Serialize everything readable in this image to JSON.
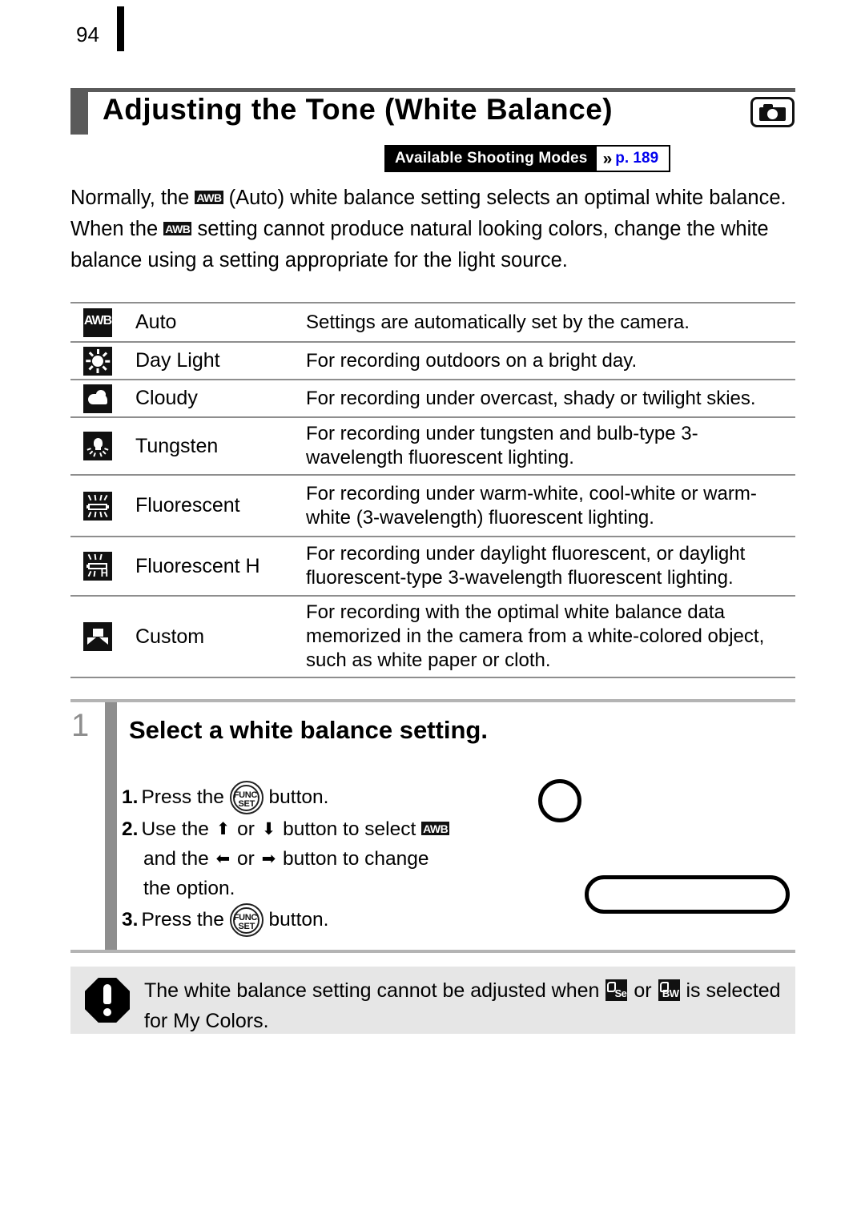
{
  "page": {
    "number": "94"
  },
  "header": {
    "title": "Adjusting the Tone (White Balance)",
    "camera_icon": "camera-icon",
    "modes_badge": {
      "label": "Available Shooting Modes",
      "chevron": "»",
      "page_ref": "p. 189",
      "page_ref_color": "#0000ee"
    }
  },
  "intro": {
    "part1": "Normally, the ",
    "icon1": "AWB",
    "part2": " (Auto) white balance setting selects an optimal white balance. When the ",
    "icon2": "AWB",
    "part3": " setting cannot produce natural looking colors, change the white balance using a setting appropriate for the light source."
  },
  "table": {
    "rows": [
      {
        "icon": "awb-icon",
        "name": "Auto",
        "description": "Settings are automatically set by the camera."
      },
      {
        "icon": "daylight-sun-icon",
        "name": "Day Light",
        "description": "For recording outdoors on a bright day."
      },
      {
        "icon": "cloudy-cloud-icon",
        "name": "Cloudy",
        "description": "For recording under overcast, shady or twilight skies."
      },
      {
        "icon": "tungsten-bulb-icon",
        "name": "Tungsten",
        "description": "For recording under tungsten and bulb-type 3-wavelength fluorescent lighting."
      },
      {
        "icon": "fluorescent-tube-icon",
        "name": "Fluorescent",
        "description": "For recording under warm-white, cool-white or warm-white (3-wavelength) fluorescent lighting."
      },
      {
        "icon": "fluorescent-h-icon",
        "name": "Fluorescent H",
        "description": "For recording under daylight fluorescent, or daylight fluorescent-type 3-wavelength fluorescent lighting."
      },
      {
        "icon": "custom-icon",
        "name": "Custom",
        "description": "For recording with the optimal white balance data memorized in the camera from a white-colored object, such as white paper or cloth."
      }
    ]
  },
  "step": {
    "number": "1",
    "title": "Select a white balance setting.",
    "items": [
      {
        "num": "1.",
        "text_before": "Press the ",
        "icon": "FUNC./SET",
        "text_after": " button."
      },
      {
        "num": "2.",
        "line1_a": "Use the ",
        "arrow_up": "⬆",
        "line1_b": " or ",
        "arrow_down": "⬇",
        "line1_c": " button to select ",
        "line1_icon": "AWB",
        "line2_a": "and the ",
        "arrow_left": "⬅",
        "line2_b": " or ",
        "arrow_right": "➡",
        "line2_c": " button to change",
        "line3": "the option."
      },
      {
        "num": "3.",
        "text_before": "Press the ",
        "icon": "FUNC./SET",
        "text_after": " button."
      }
    ],
    "func_set_icon": {
      "top": "FUNC.",
      "bottom": "SET"
    }
  },
  "illustration": {
    "circle": "button-outline-circle",
    "pill": "screen-outline-pill"
  },
  "note": {
    "icon": "warning-exclamation-icon",
    "text_a": "The white balance setting cannot be adjusted when ",
    "icon_sepia": "Se",
    "text_b": " or ",
    "icon_bw": "BW",
    "text_c": " is selected for My Colors."
  }
}
